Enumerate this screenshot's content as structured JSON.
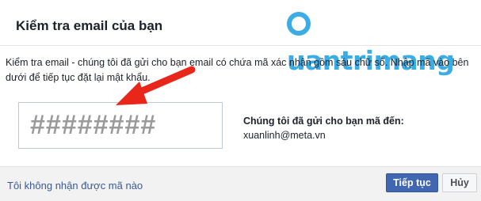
{
  "dialog": {
    "title": "Kiểm tra email của bạn",
    "watermark": "uantrimang",
    "instruction": "Kiểm tra email - chúng tôi đã gửi cho bạn email có chứa mã xác nhận gồm sáu chữ số. Nhập mã vào bên dưới để tiếp tục đặt lại mật khẩu.",
    "code_input": {
      "value": "########"
    },
    "sent_to_label": "Chúng tôi đã gửi cho bạn mã đến:",
    "sent_to_email": "xuanlinh@meta.vn"
  },
  "footer": {
    "no_code_link": "Tôi không nhận được mã nào",
    "continue_label": "Tiếp tục",
    "cancel_label": "Hủy"
  },
  "colors": {
    "arrow": "#e8271a",
    "primary_button": "#4267b2",
    "link": "#3b5998",
    "watermark": "#1b9fe0"
  },
  "icons": {
    "annotation": "red-arrow-icon"
  }
}
